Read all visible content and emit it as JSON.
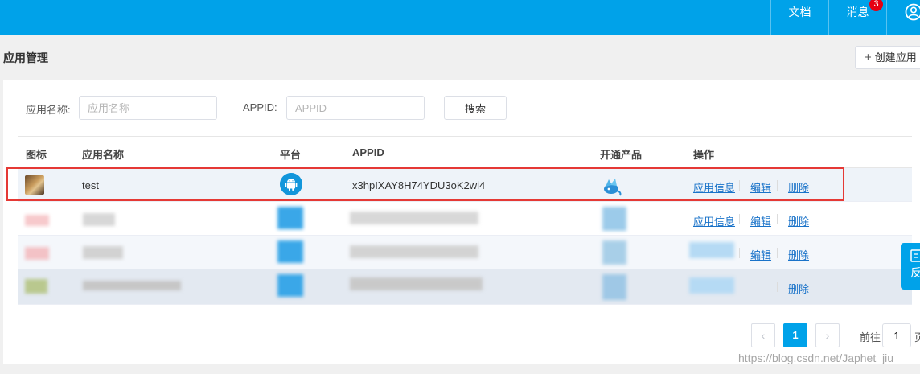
{
  "topbar": {
    "docs": "文档",
    "messages": "消息",
    "message_badge": "3"
  },
  "page": {
    "title": "应用管理",
    "create_button": "创建应用"
  },
  "filters": {
    "name_label": "应用名称:",
    "name_placeholder": "应用名称",
    "appid_label": "APPID:",
    "appid_placeholder": "APPID",
    "search_button": "搜索"
  },
  "table": {
    "headers": [
      "图标",
      "应用名称",
      "平台",
      "APPID",
      "开通产品",
      "操作"
    ],
    "rows": [
      {
        "name": "test",
        "appid": "x3hpIXAY8H74YDU3oK2wi4",
        "ops": [
          "应用信息",
          "编辑",
          "删除"
        ]
      },
      {
        "ops": [
          "应用信息",
          "编辑",
          "删除"
        ]
      },
      {
        "ops": [
          "编辑",
          "删除"
        ]
      },
      {
        "ops": [
          "删除"
        ]
      }
    ]
  },
  "pagination": {
    "prev": "‹",
    "current": "1",
    "next": "›",
    "goto_label": "前往",
    "goto_value": "1",
    "page_unit": "页"
  },
  "feedback": "反",
  "watermark": "https://blog.csdn.net/Japhet_jiu",
  "colors": {
    "brand": "#00a2e9",
    "highlight": "#e53935",
    "link": "#1a73c9",
    "badge": "#e60012"
  }
}
